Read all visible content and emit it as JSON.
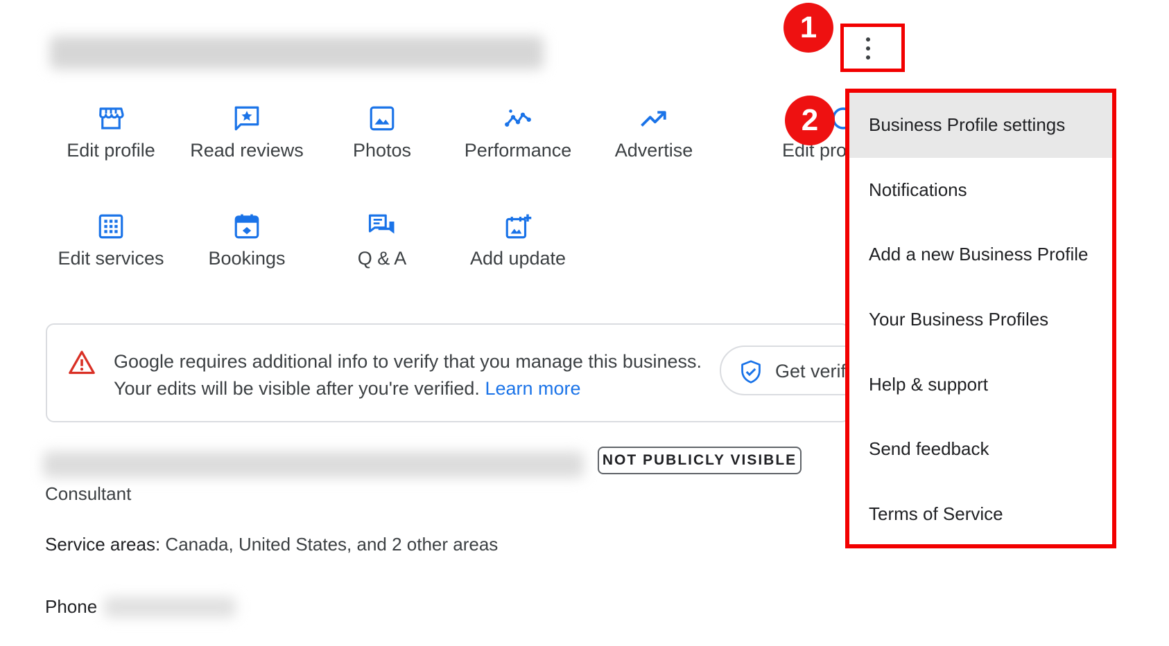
{
  "actions_row1": [
    {
      "label": "Edit profile",
      "icon": "storefront-icon"
    },
    {
      "label": "Read reviews",
      "icon": "review-star-icon"
    },
    {
      "label": "Photos",
      "icon": "photo-icon"
    },
    {
      "label": "Performance",
      "icon": "performance-icon"
    },
    {
      "label": "Advertise",
      "icon": "trending-up-icon"
    },
    {
      "label": "Edit pro",
      "icon": "edit-products-icon"
    }
  ],
  "actions_row2": [
    {
      "label": "Edit services",
      "icon": "services-grid-icon"
    },
    {
      "label": "Bookings",
      "icon": "calendar-icon"
    },
    {
      "label": "Q & A",
      "icon": "chat-bubbles-icon"
    },
    {
      "label": "Add update",
      "icon": "add-post-icon"
    }
  ],
  "alert": {
    "message": "Google requires additional info to verify that you manage this business. Your edits will be visible after you're verified.",
    "link_text": "Learn more",
    "button_label": "Get verif"
  },
  "badge": "NOT PUBLICLY VISIBLE",
  "business": {
    "category": "Consultant",
    "service_areas_label": "Service areas:",
    "service_areas_value": "Canada, United States, and 2 other areas",
    "phone_label": "Phone"
  },
  "menu": {
    "items": [
      {
        "label": "Business Profile settings"
      },
      {
        "label": "Notifications"
      },
      {
        "label": "Add a new Business Profile"
      },
      {
        "label": "Your Business Profiles"
      },
      {
        "label": "Help & support"
      },
      {
        "label": "Send feedback"
      },
      {
        "label": "Terms of Service"
      }
    ]
  },
  "steps": {
    "one": "1",
    "two": "2"
  },
  "colors": {
    "accent": "#1a73e8",
    "highlight_red": "#f20000",
    "warning_red": "#d93025"
  }
}
